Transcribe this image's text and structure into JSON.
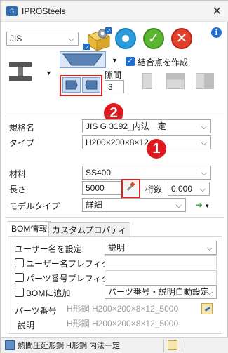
{
  "window": {
    "title": "IPROSteels",
    "close_glyph": "✕"
  },
  "toolbar": {
    "standard_value": "JIS",
    "help_glyph": "i",
    "cancel_glyph": "✕",
    "ok_glyph": "✓"
  },
  "section": {
    "create_joint_label": "結合点を作成",
    "create_joint_checked": true,
    "gap_label": "隙間",
    "gap_value": "3"
  },
  "props": {
    "standard_name_label": "規格名",
    "standard_name_value": "JIS G 3192_内法一定",
    "type_label": "タイプ",
    "type_value": "H200×200×8×12",
    "material_label": "材料",
    "material_value": "SS400",
    "length_label": "長さ",
    "length_value": "5000",
    "digits_label": "桁数",
    "digits_value": "0.000",
    "model_type_label": "モデルタイプ",
    "model_type_value": "詳細"
  },
  "tabs": [
    {
      "label": "BOM情報",
      "active": true
    },
    {
      "label": "カスタムプロパティ",
      "active": false
    }
  ],
  "bom": {
    "set_user_name_label": "ユーザー名を設定:",
    "set_user_name_value": "説明",
    "user_name_prefix_label": "ユーザー名プレフィクス",
    "part_no_prefix_label": "パーツ番号プレフィクス",
    "add_to_bom_label": "BOMに追加",
    "add_to_bom_value": "パーツ番号・説明自動設定",
    "part_number_label": "パーツ番号",
    "part_number_value": "H形鋼 H200×200×8×12_5000",
    "description_label": "説明",
    "description_value": "H形鋼 H200×200×8×12_5000"
  },
  "status": {
    "left_text": "熱間圧延形鋼 H形鋼 内法一定"
  },
  "annotations": {
    "badge1": "1",
    "badge2": "2"
  },
  "colors": {
    "accent": "#1f6fd0",
    "annotation_red": "#e0191f",
    "ok_green": "#5cb531",
    "cancel_red": "#e2402b",
    "apply_blue": "#2d9cdb"
  }
}
